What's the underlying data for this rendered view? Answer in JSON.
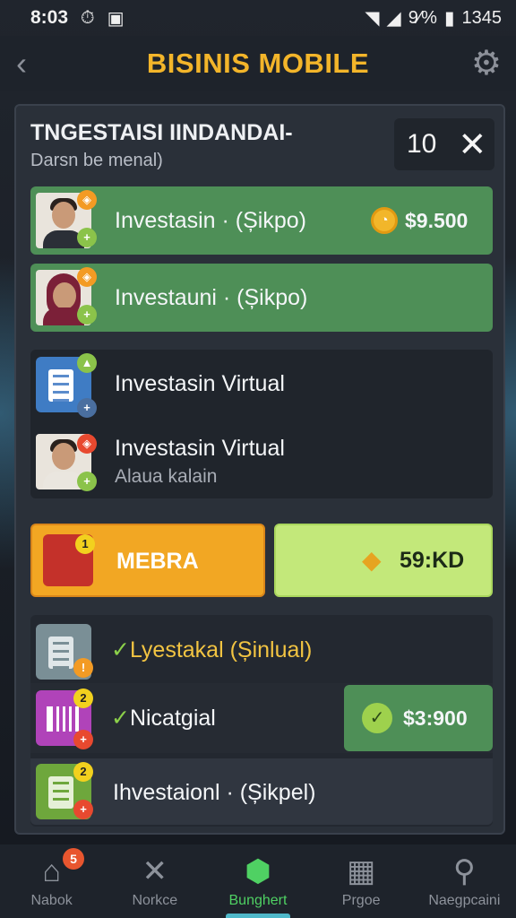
{
  "status": {
    "time": "8:03",
    "battery_text": "9⁄%",
    "clock": "1345"
  },
  "header": {
    "title": "BISINIS MOBILE"
  },
  "panel": {
    "title": "TNGESTAISI IINDANDAI-",
    "subtitle": "Darsn be menal)",
    "count": "10"
  },
  "rows": {
    "r1": {
      "label": "Investasin · (Șikpo)",
      "amount": "$9.500"
    },
    "r2": {
      "label": "Investauni · (Șikpo)"
    },
    "r3": {
      "label": "Investasin Virtual"
    },
    "r4": {
      "label": "Investasin Virtual",
      "sublabel": "Alaua kalain"
    }
  },
  "actions": {
    "membra_label": "MEBRA",
    "membra_badge": "1",
    "price_label": "59:KD"
  },
  "list": {
    "l1": {
      "label": "Lyestakal (Șinlual)"
    },
    "l2": {
      "label": "Nicatgial",
      "badge": "2",
      "amount": "$3:900"
    },
    "l3": {
      "label": "Ihvestaionl · (Șikpel)",
      "badge": "2"
    }
  },
  "nav": {
    "items": [
      {
        "label": "Nabok",
        "badge": "5"
      },
      {
        "label": "Norkce"
      },
      {
        "label": "Bunghert"
      },
      {
        "label": "Prgoe"
      },
      {
        "label": "Naegpcaini"
      }
    ]
  },
  "colors": {
    "accent": "#f3b52a",
    "green_row": "#4e8f57",
    "active_nav": "#4fd163"
  }
}
